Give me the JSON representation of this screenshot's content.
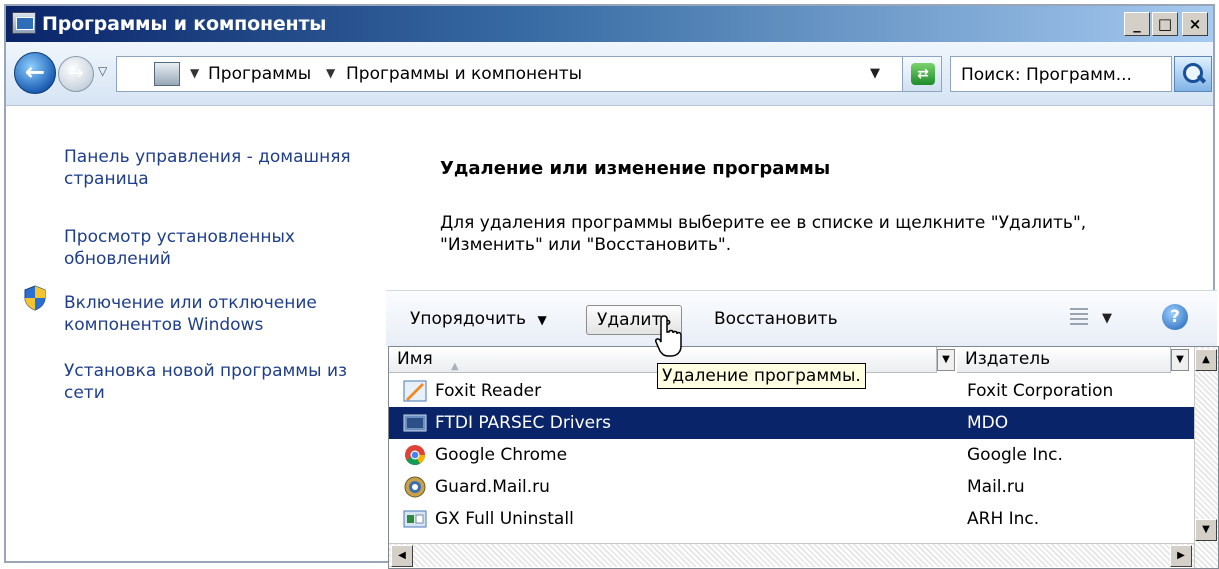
{
  "window": {
    "title": "Программы и компоненты",
    "min_label": "_",
    "max_label": "□",
    "close_label": "×"
  },
  "address": {
    "crumbs": [
      "Программы",
      "Программы и компоненты"
    ],
    "search_placeholder": "Поиск: Программ..."
  },
  "tasks": [
    {
      "label": "Панель управления - домашняя страница",
      "icon": null
    },
    {
      "label": "Просмотр установленных обновлений",
      "icon": null
    },
    {
      "label": "Включение или отключение компонентов Windows",
      "icon": "shield-icon"
    },
    {
      "label": "Установка новой программы из сети",
      "icon": null
    }
  ],
  "main": {
    "heading": "Удаление или изменение программы",
    "description": "Для удаления программы выберите ее в списке и щелкните \"Удалить\", \"Изменить\" или \"Восстановить\"."
  },
  "toolbar": {
    "organize_label": "Упорядочить",
    "uninstall_label": "Удалить",
    "repair_label": "Восстановить"
  },
  "list": {
    "columns": [
      "Имя",
      "Издатель"
    ],
    "rows": [
      {
        "name": "Foxit Reader",
        "publisher": "Foxit Corporation",
        "icon": "foxit-icon",
        "selected": false
      },
      {
        "name": "FTDI PARSEC Drivers",
        "publisher": "MDO",
        "icon": "installer-icon",
        "selected": true
      },
      {
        "name": "Google Chrome",
        "publisher": "Google Inc.",
        "icon": "chrome-icon",
        "selected": false
      },
      {
        "name": "Guard.Mail.ru",
        "publisher": "Mail.ru",
        "icon": "guard-icon",
        "selected": false
      },
      {
        "name": "GX Full Uninstall",
        "publisher": "ARH Inc.",
        "icon": "uninstaller-icon",
        "selected": false
      }
    ]
  },
  "tooltip": "Удаление программы.",
  "colors": {
    "selection": "#0a246a",
    "link": "#1e3e8c",
    "tooltip_bg": "#ffffe1"
  }
}
